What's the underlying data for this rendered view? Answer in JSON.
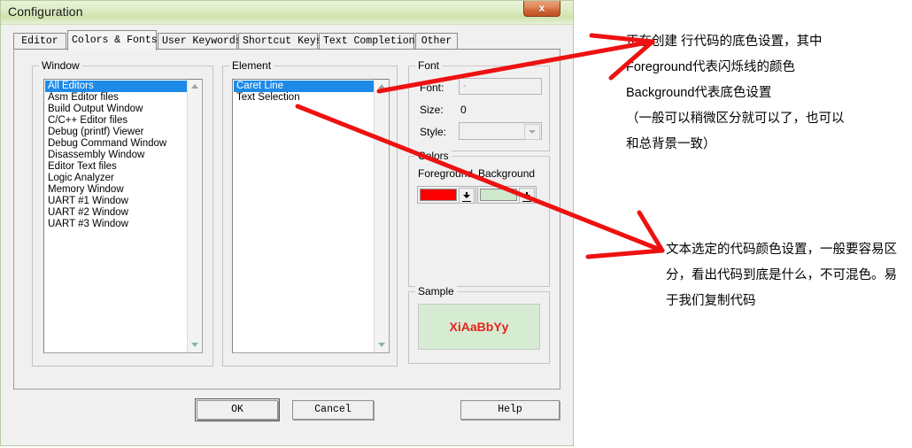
{
  "window": {
    "title": "Configuration",
    "close_label": "x"
  },
  "tabs": [
    {
      "label": "Editor",
      "active": false
    },
    {
      "label": "Colors & Fonts",
      "active": true
    },
    {
      "label": "User Keywords",
      "active": false
    },
    {
      "label": "Shortcut Keys",
      "active": false
    },
    {
      "label": "Text Completion",
      "active": false
    },
    {
      "label": "Other",
      "active": false
    }
  ],
  "window_group": {
    "legend": "Window",
    "items": [
      "All Editors",
      "Asm Editor files",
      "Build Output Window",
      "C/C++ Editor files",
      "Debug (printf) Viewer",
      "Debug Command Window",
      "Disassembly Window",
      "Editor Text files",
      "Logic Analyzer",
      "Memory Window",
      "UART #1 Window",
      "UART #2 Window",
      "UART #3 Window"
    ],
    "selected": "All Editors"
  },
  "element_group": {
    "legend": "Element",
    "items": [
      "Caret Line",
      "Text Selection"
    ],
    "selected": "Caret Line"
  },
  "font_group": {
    "legend": "Font",
    "font_label": "Font:",
    "font_value": "-",
    "size_label": "Size:",
    "size_value": "0",
    "style_label": "Style:",
    "style_value": ""
  },
  "colors_group": {
    "legend": "Colors",
    "foreground_label": "Foreground",
    "background_label": "Background",
    "foreground_color": "#fa0000",
    "background_color": "#cfe8cd"
  },
  "sample_group": {
    "legend": "Sample",
    "text": "XiAaBbYy",
    "text_color": "#e8211a",
    "background_color": "#d5ecd2"
  },
  "buttons": {
    "ok": "OK",
    "cancel": "Cancel",
    "help": "Help"
  },
  "annotations": {
    "first": [
      "正在创建 行代码的底色设置，其中",
      "Foreground代表闪烁线的颜色",
      "Background代表底色设置",
      "（一般可以稍微区分就可以了，也可以",
      "和总背景一致）"
    ],
    "second": "文本选定的代码颜色设置，一般要容易区分，看出代码到底是什么，不可混色。易于我们复制代码",
    "arrow_color": "#ee1111"
  }
}
